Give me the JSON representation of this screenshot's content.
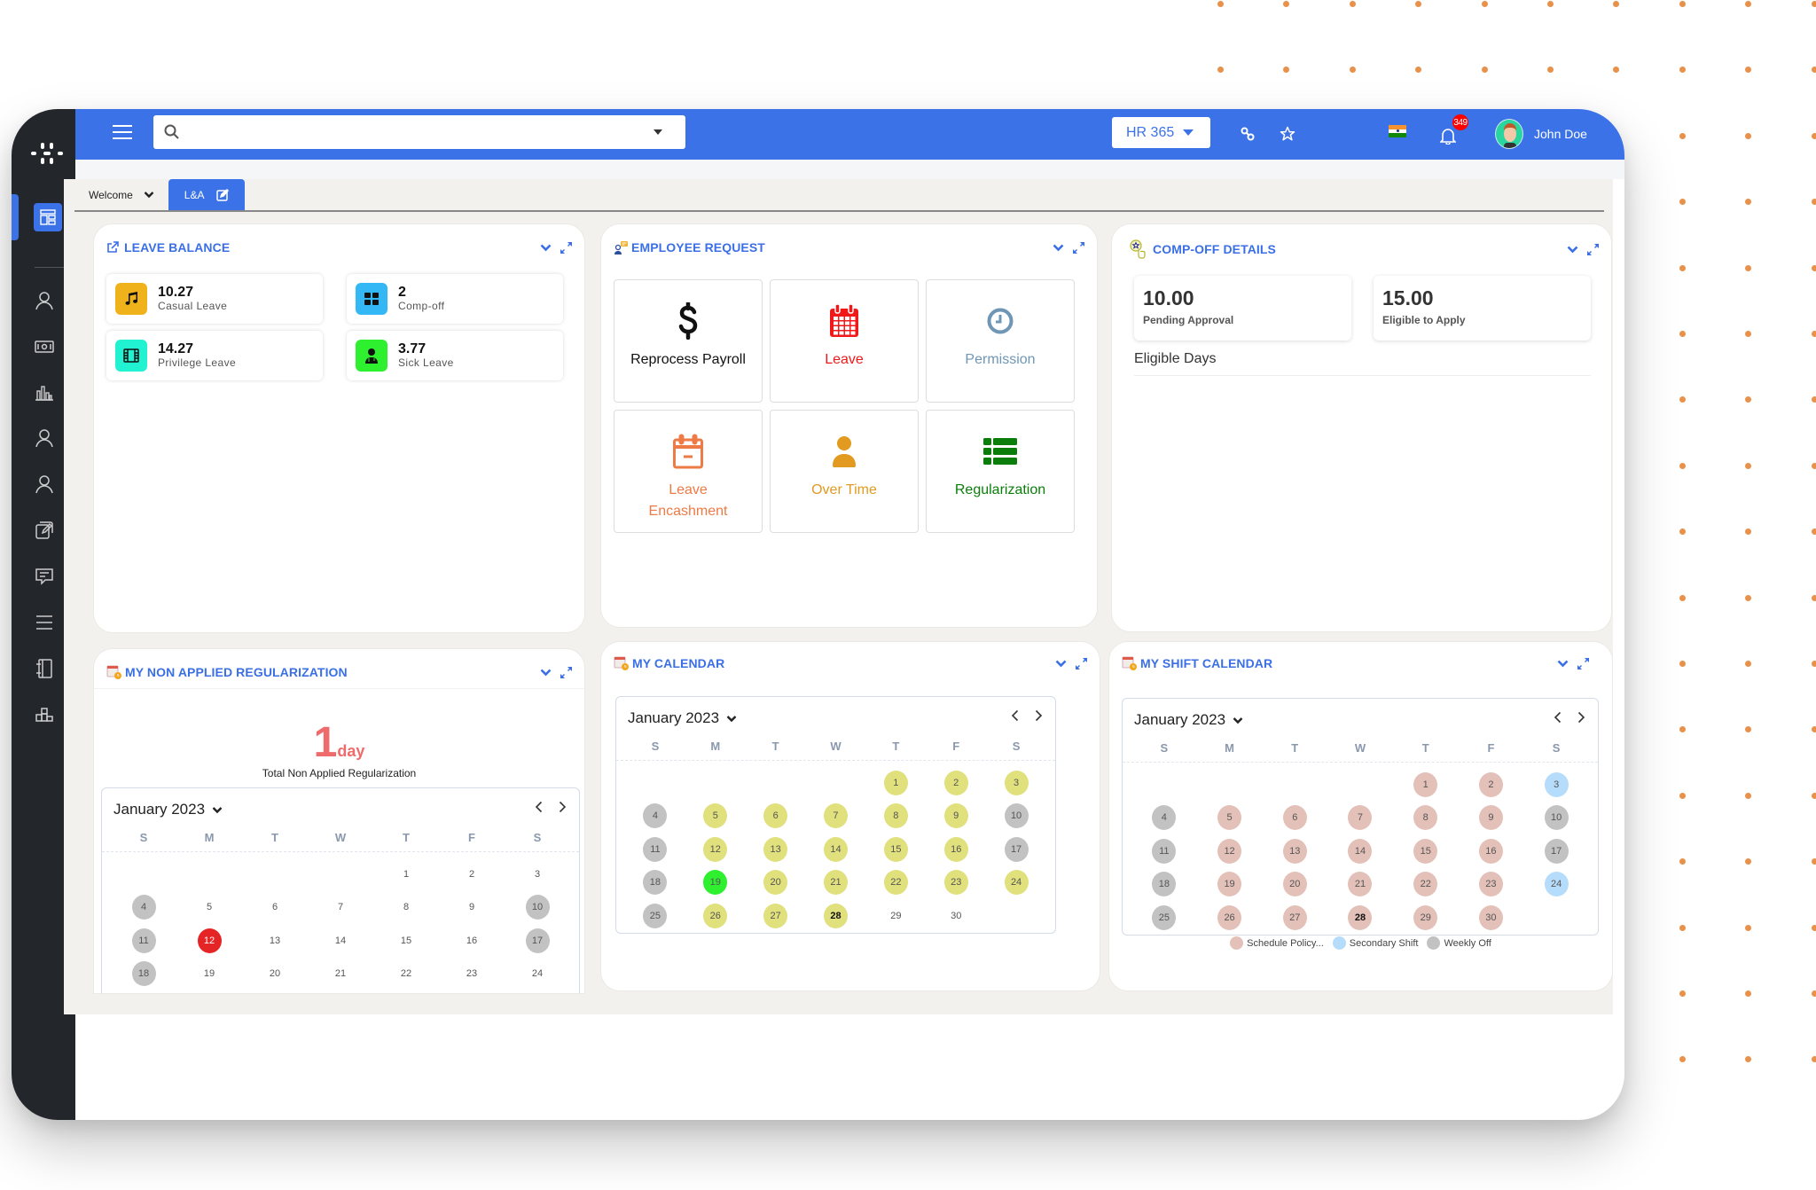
{
  "header": {
    "search_placeholder": "",
    "module_label": "HR 365",
    "notification_count": "349",
    "user_name": "John Doe"
  },
  "sidebar": {
    "items": [
      {
        "icon": "dashboard-icon",
        "active": true
      },
      {
        "icon": "user-icon"
      },
      {
        "icon": "money-icon"
      },
      {
        "icon": "bar-chart-icon"
      },
      {
        "icon": "user-icon"
      },
      {
        "icon": "user-icon"
      },
      {
        "icon": "edit-copy-icon"
      },
      {
        "icon": "message-icon"
      },
      {
        "icon": "list-icon"
      },
      {
        "icon": "notebook-icon"
      },
      {
        "icon": "org-chart-icon"
      }
    ]
  },
  "tabs": [
    {
      "label": "Welcome",
      "active": false
    },
    {
      "label": "L&A",
      "active": true
    }
  ],
  "colors": {
    "brand": "#3b72e8",
    "sidebar": "#23272b",
    "title": "#3b6fe6",
    "weekly_off": "#c2c2c2",
    "present": "#e0e07c",
    "today_green": "#2ef02e",
    "regularize_red": "#e52525",
    "schedule_policy": "#e3c1b8",
    "secondary_shift": "#b6dcfb"
  },
  "leave_balance": {
    "title": "LEAVE BALANCE",
    "items": [
      {
        "value": "10.27",
        "label": "Casual Leave",
        "icon": "music-icon",
        "color": "#f0b21b"
      },
      {
        "value": "2",
        "label": "Comp-off",
        "icon": "grid-icon",
        "color": "#34b8f5"
      },
      {
        "value": "14.27",
        "label": "Privilege Leave",
        "icon": "film-icon",
        "color": "#20f2d2"
      },
      {
        "value": "3.77",
        "label": "Sick Leave",
        "icon": "doctor-icon",
        "color": "#2ef02e"
      }
    ]
  },
  "employee_request": {
    "title": "EMPLOYEE REQUEST",
    "items": [
      {
        "label": "Reprocess Payroll",
        "icon": "dollar-icon",
        "color": "#111111"
      },
      {
        "label": "Leave",
        "icon": "calendar-icon",
        "color": "#f01818"
      },
      {
        "label": "Permission",
        "icon": "clock-icon",
        "color": "#6f97b5"
      },
      {
        "label": "Leave Encashment",
        "icon": "calendar-minus-icon",
        "color": "#ee7a45"
      },
      {
        "label": "Over Time",
        "icon": "person-icon",
        "color": "#e29a20"
      },
      {
        "label": "Regularization",
        "icon": "list-icon",
        "color": "#0a7d0a"
      }
    ]
  },
  "comp_off": {
    "title": "COMP-OFF DETAILS",
    "pending_value": "10.00",
    "pending_label": "Pending Approval",
    "eligible_value": "15.00",
    "eligible_label": "Eligible to Apply",
    "eligible_days_label": "Eligible Days"
  },
  "non_applied": {
    "title": "MY NON APPLIED REGULARIZATION",
    "count": "1",
    "unit": "day",
    "caption": "Total Non Applied Regularization",
    "calendar": {
      "month": "January 2023",
      "weekdays": [
        "S",
        "M",
        "T",
        "W",
        "T",
        "F",
        "S"
      ],
      "lead_blanks": 4,
      "days": [
        {
          "d": 1
        },
        {
          "d": 2
        },
        {
          "d": 3
        },
        {
          "d": 4,
          "s": "off"
        },
        {
          "d": 5
        },
        {
          "d": 6
        },
        {
          "d": 7
        },
        {
          "d": 8
        },
        {
          "d": 9
        },
        {
          "d": 10,
          "s": "off"
        },
        {
          "d": 11,
          "s": "off"
        },
        {
          "d": 12,
          "s": "red"
        },
        {
          "d": 13
        },
        {
          "d": 14
        },
        {
          "d": 15
        },
        {
          "d": 16
        },
        {
          "d": 17,
          "s": "off"
        },
        {
          "d": 18,
          "s": "off"
        },
        {
          "d": 19
        },
        {
          "d": 20
        },
        {
          "d": 21
        },
        {
          "d": 22
        },
        {
          "d": 23
        },
        {
          "d": 24
        }
      ]
    }
  },
  "my_calendar": {
    "title": "MY CALENDAR",
    "calendar": {
      "month": "January 2023",
      "weekdays": [
        "S",
        "M",
        "T",
        "W",
        "T",
        "F",
        "S"
      ],
      "lead_blanks": 4,
      "days": [
        {
          "d": 1,
          "s": "present"
        },
        {
          "d": 2,
          "s": "present"
        },
        {
          "d": 3,
          "s": "present"
        },
        {
          "d": 4,
          "s": "off"
        },
        {
          "d": 5,
          "s": "present"
        },
        {
          "d": 6,
          "s": "present"
        },
        {
          "d": 7,
          "s": "present"
        },
        {
          "d": 8,
          "s": "present"
        },
        {
          "d": 9,
          "s": "present"
        },
        {
          "d": 10,
          "s": "off"
        },
        {
          "d": 11,
          "s": "off"
        },
        {
          "d": 12,
          "s": "present"
        },
        {
          "d": 13,
          "s": "present"
        },
        {
          "d": 14,
          "s": "present"
        },
        {
          "d": 15,
          "s": "present"
        },
        {
          "d": 16,
          "s": "present"
        },
        {
          "d": 17,
          "s": "off"
        },
        {
          "d": 18,
          "s": "off"
        },
        {
          "d": 19,
          "s": "green"
        },
        {
          "d": 20,
          "s": "present"
        },
        {
          "d": 21,
          "s": "present"
        },
        {
          "d": 22,
          "s": "present"
        },
        {
          "d": 23,
          "s": "present"
        },
        {
          "d": 24,
          "s": "present"
        },
        {
          "d": 25,
          "s": "off"
        },
        {
          "d": 26,
          "s": "present"
        },
        {
          "d": 27,
          "s": "present"
        },
        {
          "d": 28,
          "s": "present",
          "bold": true
        },
        {
          "d": 29
        },
        {
          "d": 30
        }
      ]
    }
  },
  "shift_calendar": {
    "title": "MY SHIFT CALENDAR",
    "calendar": {
      "month": "January 2023",
      "weekdays": [
        "S",
        "M",
        "T",
        "W",
        "T",
        "F",
        "S"
      ],
      "lead_blanks": 4,
      "days": [
        {
          "d": 1,
          "s": "policy"
        },
        {
          "d": 2,
          "s": "policy"
        },
        {
          "d": 3,
          "s": "secondary"
        },
        {
          "d": 4,
          "s": "off"
        },
        {
          "d": 5,
          "s": "policy"
        },
        {
          "d": 6,
          "s": "policy"
        },
        {
          "d": 7,
          "s": "policy"
        },
        {
          "d": 8,
          "s": "policy"
        },
        {
          "d": 9,
          "s": "policy"
        },
        {
          "d": 10,
          "s": "off"
        },
        {
          "d": 11,
          "s": "off"
        },
        {
          "d": 12,
          "s": "policy"
        },
        {
          "d": 13,
          "s": "policy"
        },
        {
          "d": 14,
          "s": "policy"
        },
        {
          "d": 15,
          "s": "policy"
        },
        {
          "d": 16,
          "s": "policy"
        },
        {
          "d": 17,
          "s": "off"
        },
        {
          "d": 18,
          "s": "off"
        },
        {
          "d": 19,
          "s": "policy"
        },
        {
          "d": 20,
          "s": "policy"
        },
        {
          "d": 21,
          "s": "policy"
        },
        {
          "d": 22,
          "s": "policy"
        },
        {
          "d": 23,
          "s": "policy"
        },
        {
          "d": 24,
          "s": "secondary"
        },
        {
          "d": 25,
          "s": "off"
        },
        {
          "d": 26,
          "s": "policy"
        },
        {
          "d": 27,
          "s": "policy"
        },
        {
          "d": 28,
          "s": "policy",
          "bold": true
        },
        {
          "d": 29,
          "s": "policy"
        },
        {
          "d": 30,
          "s": "policy"
        }
      ]
    },
    "legend": [
      {
        "label": "Schedule Policy...",
        "s": "policy"
      },
      {
        "label": "Secondary Shift",
        "s": "secondary"
      },
      {
        "label": "Weekly Off",
        "s": "off"
      }
    ]
  }
}
